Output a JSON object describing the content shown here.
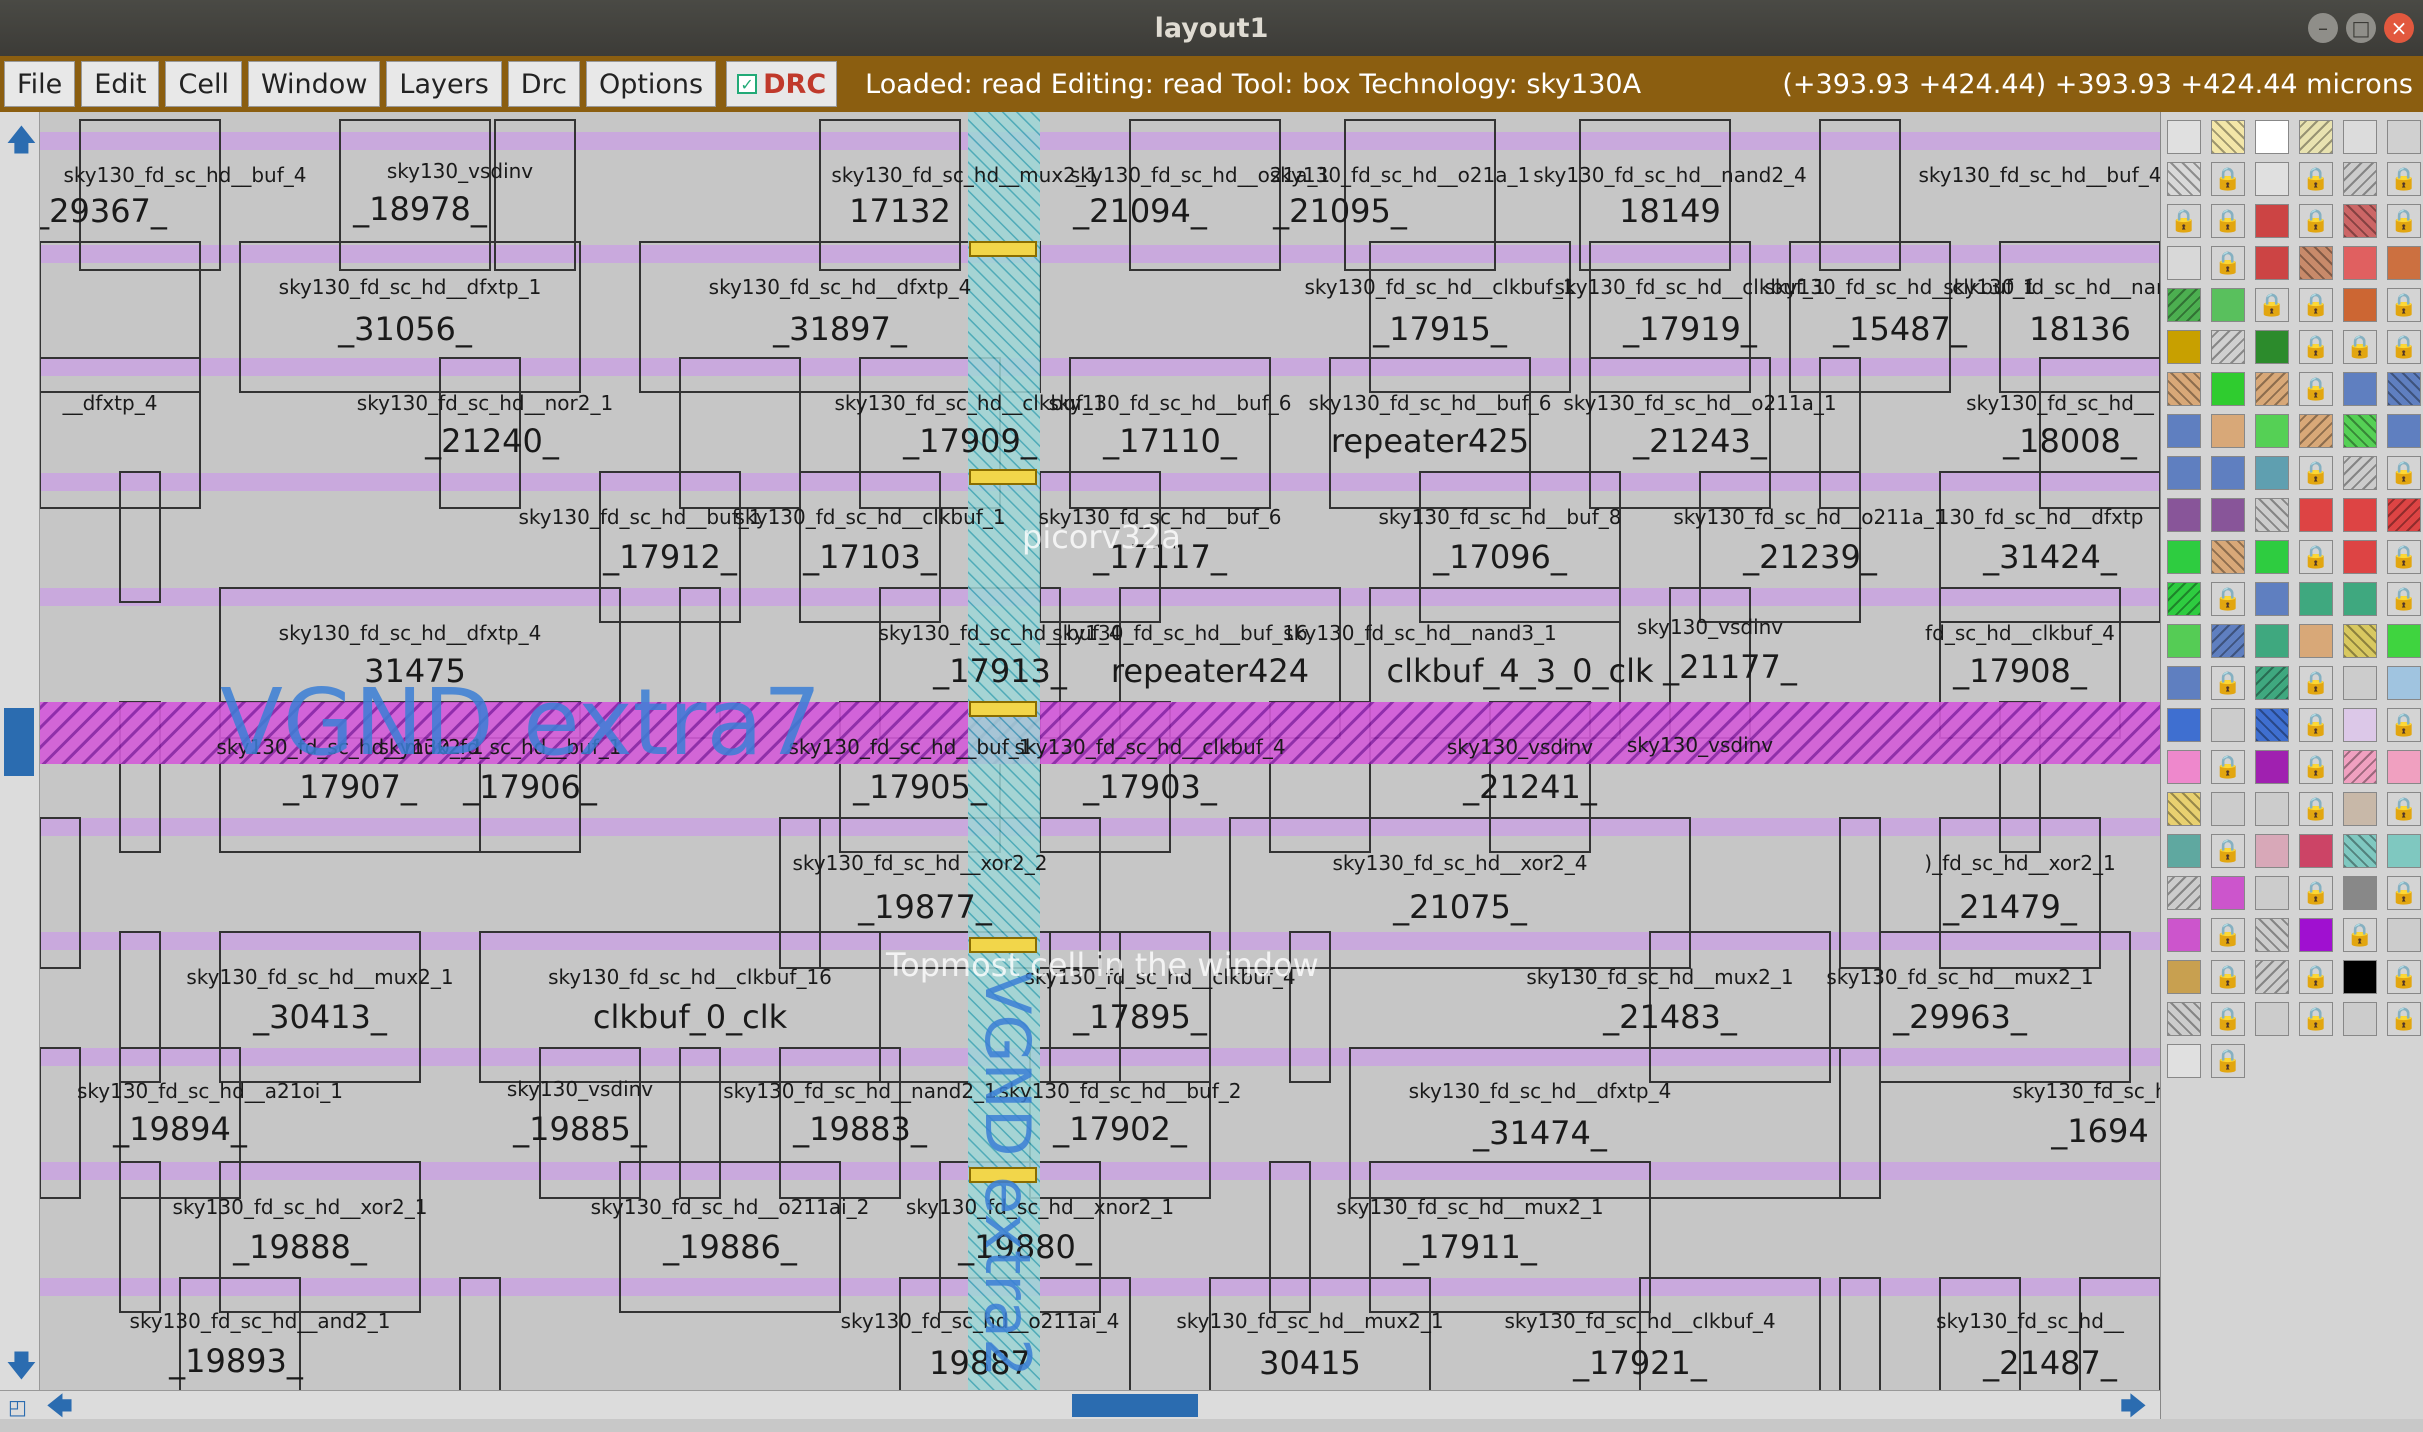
{
  "window": {
    "title": "layout1"
  },
  "menu": {
    "items": [
      "File",
      "Edit",
      "Cell",
      "Window",
      "Layers",
      "Drc",
      "Options"
    ],
    "drc_label": "DRC"
  },
  "status": {
    "text": "Loaded: read Editing: read Tool: box  Technology: sky130A",
    "coords": "(+393.93 +424.44) +393.93 +424.44 microns"
  },
  "overlay": {
    "vgnd_extra": "VGND extra7",
    "vgnd_vertical": "VGND extra2",
    "picorv": "picorv32a",
    "topmost": "Topmost cell in the window"
  },
  "cells": [
    {
      "t": "sky130_fd_sc_hd__buf_4",
      "id": "_29367_"
    },
    {
      "t": "sky130_vsdinv",
      "id": "_18978_"
    },
    {
      "t": "sky130_fd_sc_hd__mux2_1",
      "id": "17132"
    },
    {
      "t": "sky130_fd_sc_hd__o21a_1",
      "id": "_21094_"
    },
    {
      "t": "sky130_fd_sc_hd__o21a_1",
      "id": "_21095_"
    },
    {
      "t": "sky130_fd_sc_hd__nand2_4",
      "id": "18149"
    },
    {
      "t": "sky130_fd_sc_hd__dfxtp_1",
      "id": "_31056_"
    },
    {
      "t": "sky130_fd_sc_hd__dfxtp_4",
      "id": "_31897_"
    },
    {
      "t": "sky130_fd_sc_hd__clkbuf_1",
      "id": "_17915_"
    },
    {
      "t": "sky130_fd_sc_hd__clkbuf_1",
      "id": "_17919_"
    },
    {
      "t": "sky130_fd_sc_hd__clkbuf_1",
      "id": "_15487_"
    },
    {
      "t": "sky130_fd_sc_hd__nand2_1",
      "id": "18136"
    },
    {
      "t": "__dfxtp_4",
      "id": ""
    },
    {
      "t": "sky130_fd_sc_hd__nor2_1",
      "id": "_21240_"
    },
    {
      "t": "sky130_fd_sc_hd__clkbuf_1",
      "id": "_17909_"
    },
    {
      "t": "sky130_fd_sc_hd__buf_6",
      "id": "_17110_"
    },
    {
      "t": "sky130_fd_sc_hd__buf_6",
      "id": "repeater425"
    },
    {
      "t": "sky130_fd_sc_hd__o211a_1",
      "id": "_21243_"
    },
    {
      "t": "sky130_fd_sc_hd__",
      "id": "_18008_"
    },
    {
      "t": "sky130_fd_sc_hd__buf_1",
      "id": "_17912_"
    },
    {
      "t": "sky130_fd_sc_hd__clkbuf_1",
      "id": "_17103_"
    },
    {
      "t": "sky130_fd_sc_hd__buf_6",
      "id": "_17117_"
    },
    {
      "t": "sky130_fd_sc_hd__buf_8",
      "id": "_17096_"
    },
    {
      "t": "sky130_fd_sc_hd__o211a_1",
      "id": "_21239_"
    },
    {
      "t": "130_fd_sc_hd__dfxtp",
      "id": "_31424_"
    },
    {
      "t": "sky130_fd_sc_hd__dfxtp_4",
      "id": "31475"
    },
    {
      "t": "sky130_fd_sc_hd__buf_4",
      "id": "_17913_"
    },
    {
      "t": "sky130_fd_sc_hd__buf_16",
      "id": "repeater424"
    },
    {
      "t": "sky130_fd_sc_hd__nand3_1",
      "id": "clkbuf_4_3_0_clk"
    },
    {
      "t": "sky130_vsdinv",
      "id": "_21177_"
    },
    {
      "t": "fd_sc_hd__clkbuf_4",
      "id": "_17908_"
    },
    {
      "t": "sky130_fd_sc_hd__mux2_1",
      "id": "_17907_"
    },
    {
      "t": "sky130_fd_sc_hd__buf_1",
      "id": "_17906_"
    },
    {
      "t": "sky130_fd_sc_hd__buf_1",
      "id": "_17905_"
    },
    {
      "t": "sky130_fd_sc_hd__clkbuf_4",
      "id": "_17903_"
    },
    {
      "t": "sky130_vsdinv",
      "id": "_21241_"
    },
    {
      "t": "sky130_fd_sc_hd__xor2_2",
      "id": "_19877_"
    },
    {
      "t": "sky130_fd_sc_hd__xor2_4",
      "id": "_21075_"
    },
    {
      "t": ")_fd_sc_hd__xor2_1",
      "id": "_21479_"
    },
    {
      "t": "sky130_fd_sc_hd__mux2_1",
      "id": "_30413_"
    },
    {
      "t": "sky130_fd_sc_hd__clkbuf_16",
      "id": "clkbuf_0_clk"
    },
    {
      "t": "sky130_fd_sc_hd__clkbuf_4",
      "id": "_17895_"
    },
    {
      "t": "sky130_fd_sc_hd__mux2_1",
      "id": "_21483_"
    },
    {
      "t": "sky130_fd_sc_hd__mux2_1",
      "id": "_29963_"
    },
    {
      "t": "sky130_fd_sc_hd__a21oi_1",
      "id": "_19894_"
    },
    {
      "t": "sky130_vsdinv",
      "id": "_19885_"
    },
    {
      "t": "sky130_fd_sc_hd__nand2_1",
      "id": "_19883_"
    },
    {
      "t": "sky130_fd_sc_hd__buf_2",
      "id": "_17902_"
    },
    {
      "t": "sky130_fd_sc_hd__dfxtp_4",
      "id": "_31474_"
    },
    {
      "t": "sky130_fd_sc_h",
      "id": "_1694"
    },
    {
      "t": "sky130_fd_sc_hd__xor2_1",
      "id": "_19888_"
    },
    {
      "t": "sky130_fd_sc_hd__o211ai_2",
      "id": "_19886_"
    },
    {
      "t": "sky130_fd_sc_hd__xnor2_1",
      "id": "_19880_"
    },
    {
      "t": "sky130_fd_sc_hd__mux2_1",
      "id": "_17911_"
    },
    {
      "t": "sky130_fd_sc_hd__and2_1",
      "id": "_19893_"
    },
    {
      "t": "sky130_fd_sc_hd__o211ai_4",
      "id": "19887"
    },
    {
      "t": "sky130_fd_sc_hd__mux2_1",
      "id": "30415"
    },
    {
      "t": "sky130_fd_sc_hd__clkbuf_4",
      "id": "_17921_"
    },
    {
      "t": "sky130_fd_sc_hd__",
      "id": "_21487_"
    },
    {
      "t": "sky130_fd_sc_hd__buf_4",
      "id": ""
    },
    {
      "t": "sky130_vsdinv",
      "id": ""
    }
  ],
  "palette": {
    "lock_glyph": "🔒"
  }
}
